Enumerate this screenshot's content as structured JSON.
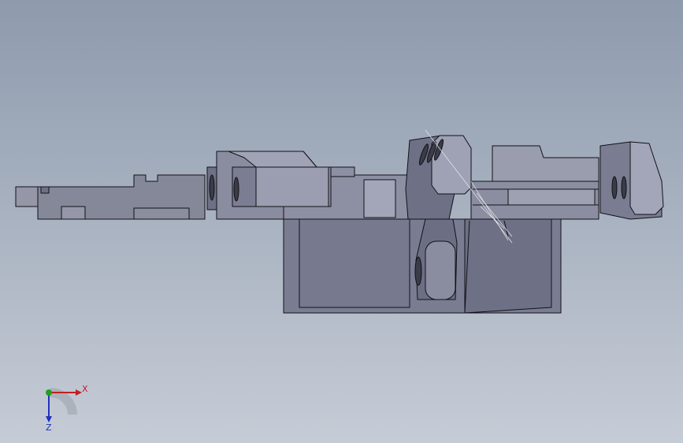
{
  "viewport": {
    "background_top": "#8e9bad",
    "background_bottom": "#c6ccd6",
    "part_color": "#7a7d91",
    "part_light": "#9a9db2",
    "edge_color": "#111118"
  },
  "triad": {
    "x_label": "X",
    "z_label": "Z",
    "x_color": "#c02020",
    "y_color": "#20a020",
    "z_color": "#2030c0"
  }
}
